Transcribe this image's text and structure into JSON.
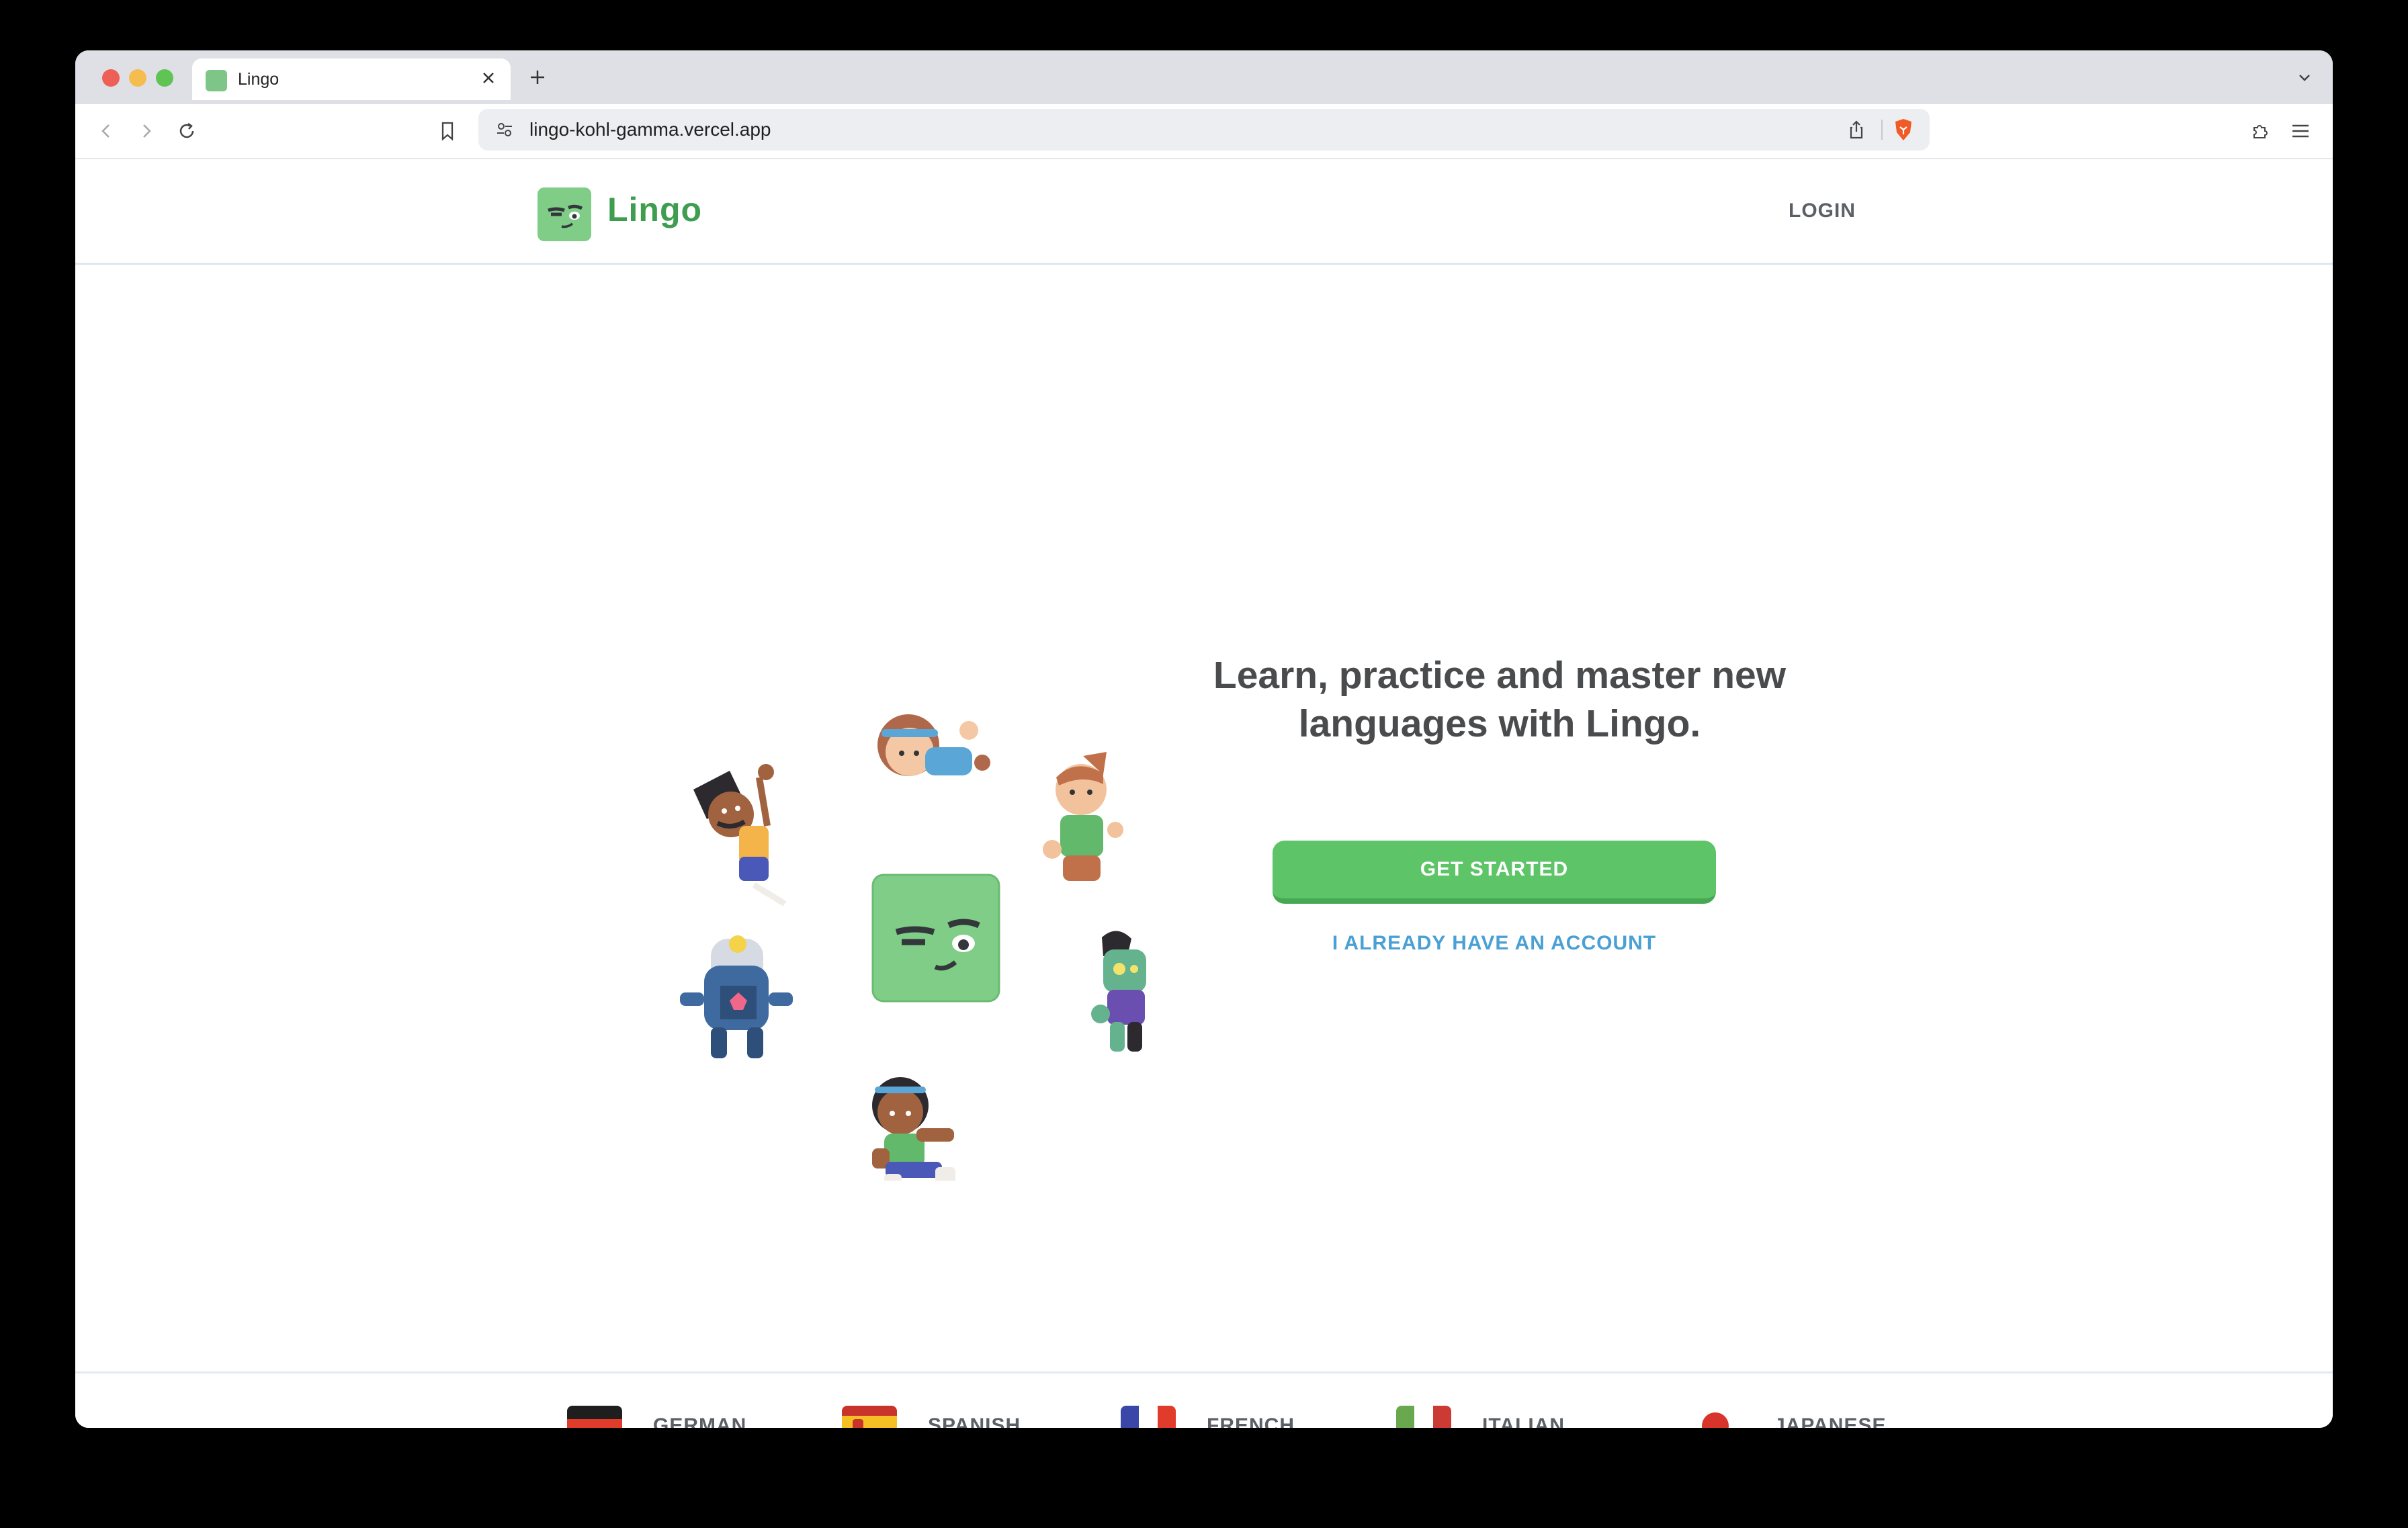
{
  "browser": {
    "tab_title": "Lingo",
    "url": "lingo-kohl-gamma.vercel.app"
  },
  "header": {
    "brand_name": "Lingo",
    "login_label": "LOGIN"
  },
  "hero": {
    "title": "Learn, practice and master new languages with Lingo.",
    "primary_button": "GET STARTED",
    "secondary_link": "I ALREADY HAVE AN ACCOUNT"
  },
  "languages": [
    {
      "label": "GERMAN",
      "flag": "germany-flag"
    },
    {
      "label": "SPANISH",
      "flag": "spain-flag"
    },
    {
      "label": "FRENCH",
      "flag": "france-flag"
    },
    {
      "label": "ITALIAN",
      "flag": "italy-flag"
    },
    {
      "label": "JAPANESE",
      "flag": "japan-flag"
    }
  ],
  "colors": {
    "brand_green": "#3f9d4f",
    "button_green": "#5ec468",
    "link_blue": "#4aa0d5"
  }
}
